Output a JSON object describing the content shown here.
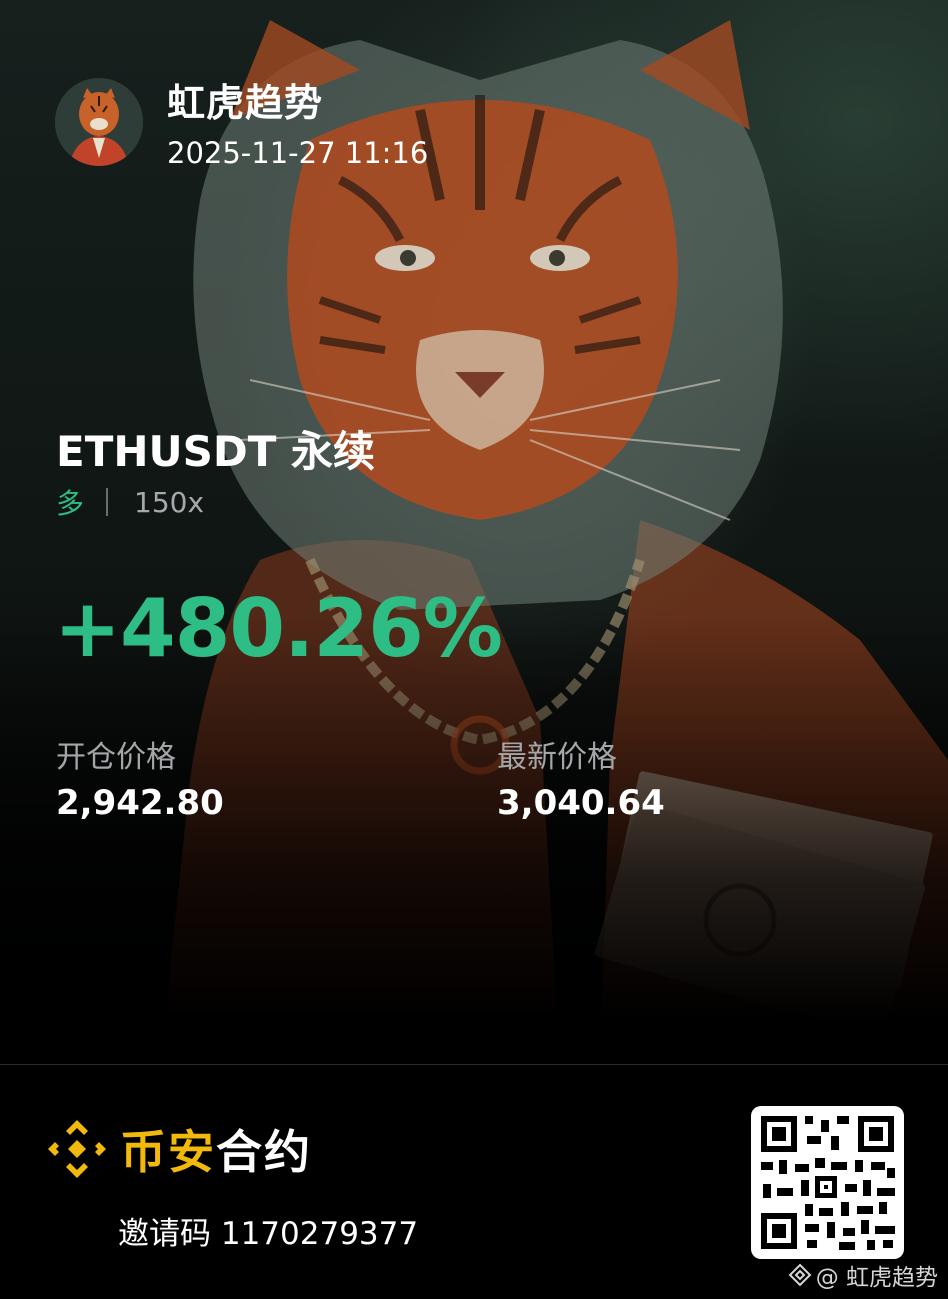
{
  "post": {
    "author": "虹虎趋势",
    "datetime": "2025-11-27 11:16"
  },
  "position": {
    "symbol": "ETHUSDT 永续",
    "side": "多",
    "leverage": "150x",
    "pnl_percent": "+480.26%",
    "entry_label": "开仓价格",
    "entry_value": "2,942.80",
    "last_label": "最新价格",
    "last_value": "3,040.64"
  },
  "footer": {
    "brand_part1": "币安",
    "brand_part2": "合约",
    "invite_label": "邀请码",
    "invite_code": "1170279377",
    "watermark": "@ 虹虎趋势"
  },
  "colors": {
    "profit_green": "#2ebd85",
    "brand_yellow": "#f0b90b",
    "background": "#000000"
  },
  "icons": {
    "logo": "binance-logo-icon",
    "qr": "qr-code-icon",
    "watermark": "binance-diamond-icon"
  }
}
